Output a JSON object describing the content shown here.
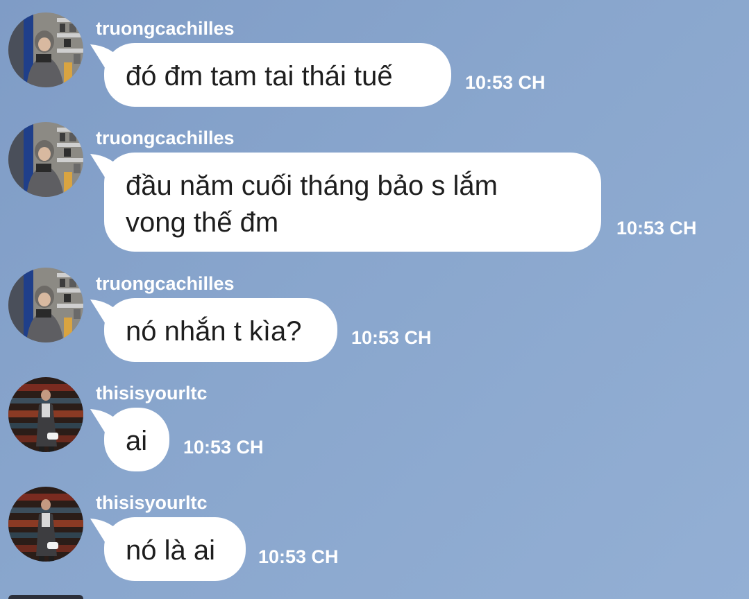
{
  "messages": [
    {
      "sender": "truongcachilles",
      "text": "đó đm tam tai thái tuế",
      "time": "10:53 CH",
      "avatar": "avatar-truongcachilles"
    },
    {
      "sender": "truongcachilles",
      "text": "đầu năm cuối tháng bảo s lắm\nvong thế đm",
      "time": "10:53 CH",
      "avatar": "avatar-truongcachilles"
    },
    {
      "sender": "truongcachilles",
      "text": "nó nhắn t kìa?",
      "time": "10:53 CH",
      "avatar": "avatar-truongcachilles"
    },
    {
      "sender": "thisisyourltc",
      "text": "ai",
      "time": "10:53 CH",
      "avatar": "avatar-thisisyourltc"
    },
    {
      "sender": "thisisyourltc",
      "text": "nó là ai",
      "time": "10:53 CH",
      "avatar": "avatar-thisisyourltc"
    }
  ],
  "colors": {
    "background": "#89a6cd",
    "bubble": "#ffffff",
    "text": "#1e1e1e",
    "meta": "#ffffff"
  }
}
